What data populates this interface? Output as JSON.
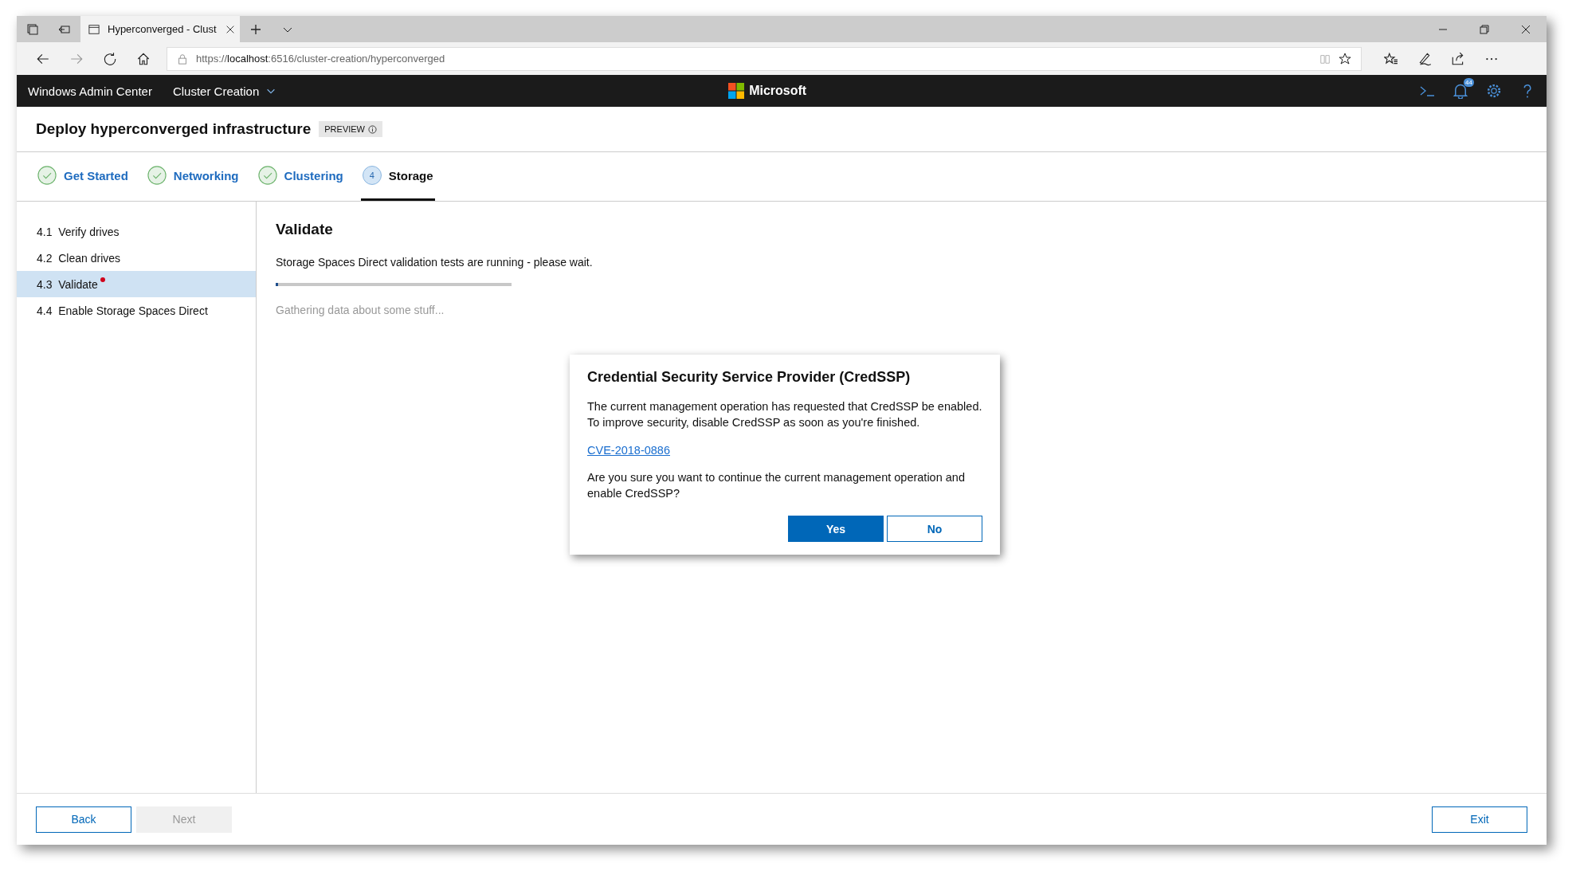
{
  "browser": {
    "tab_title": "Hyperconverged - Clust",
    "url": {
      "scheme": "https://",
      "host": "localhost",
      "path": ":6516/cluster-creation/hyperconverged"
    }
  },
  "app_bar": {
    "brand": "Windows Admin Center",
    "menu": "Cluster Creation",
    "logo_text": "Microsoft",
    "notification_count": "44"
  },
  "page": {
    "title": "Deploy hyperconverged infrastructure",
    "badge": "PREVIEW"
  },
  "steps": [
    {
      "label": "Get Started",
      "kind": "done",
      "selected": false
    },
    {
      "label": "Networking",
      "kind": "done",
      "selected": false
    },
    {
      "label": "Clustering",
      "kind": "done",
      "selected": false
    },
    {
      "label": "Storage",
      "kind": "current",
      "number": "4",
      "selected": true
    }
  ],
  "sidebar": {
    "items": [
      {
        "number": "4.1",
        "label": "Verify drives",
        "selected": false,
        "alert": false
      },
      {
        "number": "4.2",
        "label": "Clean drives",
        "selected": false,
        "alert": false
      },
      {
        "number": "4.3",
        "label": "Validate",
        "selected": true,
        "alert": true
      },
      {
        "number": "4.4",
        "label": "Enable Storage Spaces Direct",
        "selected": false,
        "alert": false
      }
    ]
  },
  "content": {
    "heading": "Validate",
    "message": "Storage Spaces Direct validation tests are running - please wait.",
    "progress": {
      "level": 0.01
    },
    "status": "Gathering data about some stuff..."
  },
  "dialog": {
    "title": "Credential Security Service Provider (CredSSP)",
    "body": "The current management operation has requested that CredSSP be enabled. To improve security, disable CredSSP as soon as you're finished.",
    "link": "CVE-2018-0886",
    "question": "Are you sure you want to continue the current management operation and enable CredSSP?",
    "buttons": [
      {
        "label": "Yes",
        "kind": "primary"
      },
      {
        "label": "No",
        "kind": "secondary"
      }
    ]
  },
  "footer": {
    "buttons": [
      {
        "label": "Back",
        "disabled": false
      },
      {
        "label": "Next",
        "disabled": true
      }
    ],
    "exit": "Exit"
  }
}
